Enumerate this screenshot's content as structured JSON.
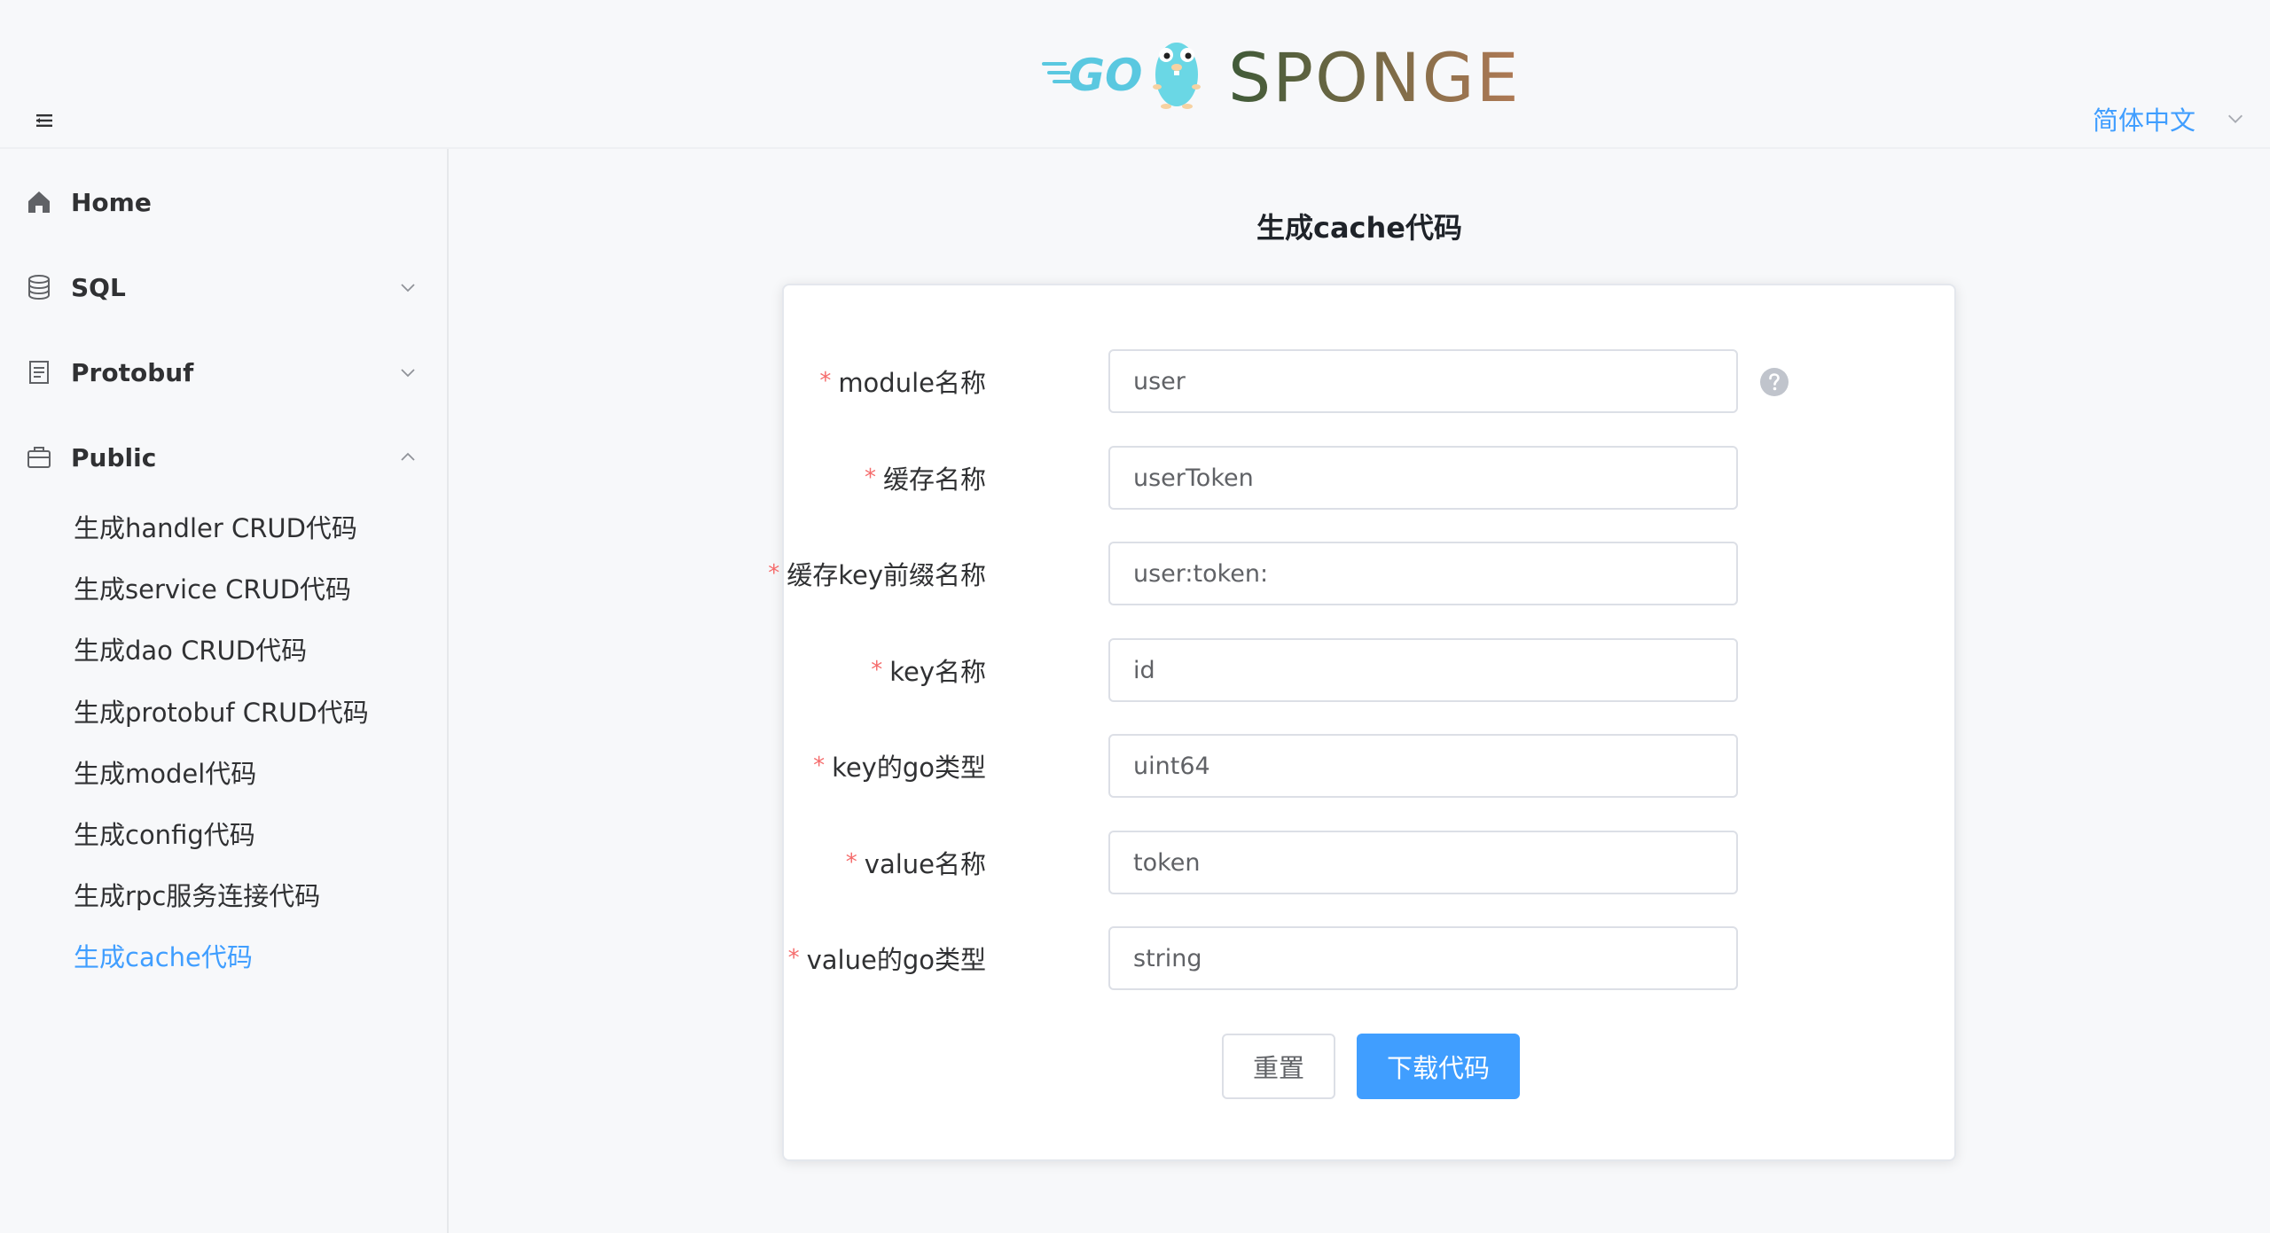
{
  "header": {
    "logo_go_text": "GO",
    "logo_text": "SPONGE",
    "language": "简体中文",
    "brand_colors": {
      "go_blue": "#5ac8e0",
      "sponge_gradient_start": "#3f5a38",
      "sponge_gradient_end": "#b07a55"
    }
  },
  "sidebar": {
    "items": [
      {
        "label": "Home",
        "icon": "home-icon"
      },
      {
        "label": "SQL",
        "icon": "database-icon",
        "arrow": "chevron-down-icon"
      },
      {
        "label": "Protobuf",
        "icon": "document-icon",
        "arrow": "chevron-down-icon"
      },
      {
        "label": "Public",
        "icon": "briefcase-icon",
        "arrow": "chevron-up-icon"
      }
    ],
    "public_sub_items": [
      {
        "label": "生成handler CRUD代码"
      },
      {
        "label": "生成service CRUD代码"
      },
      {
        "label": "生成dao CRUD代码"
      },
      {
        "label": "生成protobuf CRUD代码"
      },
      {
        "label": "生成model代码"
      },
      {
        "label": "生成config代码"
      },
      {
        "label": "生成rpc服务连接代码"
      },
      {
        "label": "生成cache代码",
        "active": true
      }
    ]
  },
  "main": {
    "title": "生成cache代码",
    "form": {
      "fields": [
        {
          "label": "module名称",
          "value": "user",
          "required": true
        },
        {
          "label": "缓存名称",
          "value": "userToken",
          "required": true
        },
        {
          "label": "缓存key前缀名称",
          "value": "user:token:",
          "required": true
        },
        {
          "label": "key名称",
          "value": "id",
          "required": true
        },
        {
          "label": "key的go类型",
          "value": "uint64",
          "required": true
        },
        {
          "label": "value名称",
          "value": "token",
          "required": true
        },
        {
          "label": "value的go类型",
          "value": "string",
          "required": true
        }
      ],
      "required_mark": "*",
      "reset_label": "重置",
      "download_label": "下载代码"
    }
  },
  "colors": {
    "accent": "#409eff",
    "required": "#f56c6c",
    "text": "#303133"
  }
}
